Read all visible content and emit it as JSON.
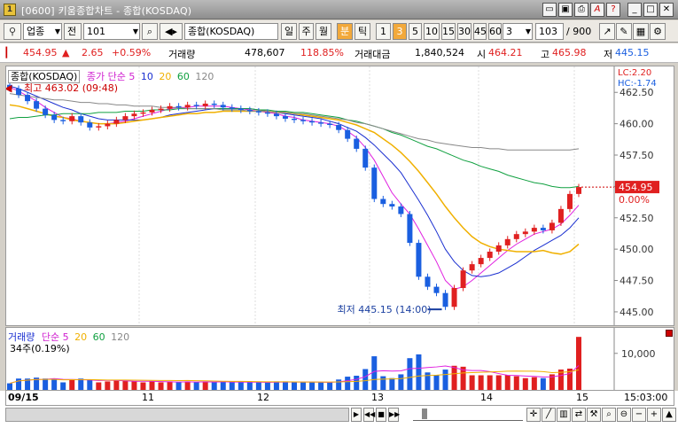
{
  "window": {
    "title": "[0600] 키움종합차트 - 종합(KOSDAQ)",
    "controls": [
      "restore",
      "minimize-alt",
      "print",
      "font",
      "help",
      "minimize",
      "maximize",
      "close"
    ]
  },
  "toolbar": {
    "category": "업종",
    "market": "전",
    "code": "101",
    "name": "종합(KOSDAQ)",
    "periods": [
      "일",
      "주",
      "월",
      "분",
      "틱",
      "1",
      "3",
      "5",
      "10",
      "15",
      "30",
      "45",
      "60"
    ],
    "active_period": "3",
    "period_input": "3",
    "count": "103",
    "count_total": "/ 900"
  },
  "quote": {
    "price": "454.95",
    "arrow": "▲",
    "change": "2.65",
    "rate": "+0.59%",
    "vol_label": "거래량",
    "vol": "478,607",
    "vol_rate": "118.85%",
    "amt_label": "거래대금",
    "amt": "1,840,524",
    "open_label": "시",
    "open": "464.21",
    "high_label": "고",
    "high": "465.98",
    "low_label": "저",
    "low": "445.15"
  },
  "price_pane": {
    "legend_name": "종합(KOSDAQ)",
    "legend_ma": "종가 단순",
    "ma": [
      "5",
      "10",
      "20",
      "60",
      "120"
    ],
    "lc": "LC:2.20",
    "hc": "HC:-1.74",
    "max_ann": "최고 463.02 (09:48)",
    "min_ann": "최저 445.15 (14:00)",
    "last": "454.95",
    "last_pct": "0.00%"
  },
  "volume_pane": {
    "legend_name": "거래량",
    "legend_ma": "단순",
    "ma": [
      "5",
      "20",
      "60",
      "120"
    ],
    "unit": "34주(0.19%)"
  },
  "x_labels": [
    "09/15",
    "11",
    "12",
    "13",
    "14",
    "15"
  ],
  "status_time": "15:03:00",
  "colors": {
    "up": "#e02020",
    "down": "#1a5fe0",
    "ma5": "#e020e0",
    "ma10": "#1a2fd0",
    "ma20": "#f0b000",
    "ma60": "#10a040",
    "ma120": "#888888"
  },
  "chart_data": {
    "type": "candlestick",
    "series": [
      {
        "name": "종합(KOSDAQ)",
        "values": [
          462.8,
          462.3,
          461.8,
          461.2,
          460.7,
          460.3,
          460.2,
          460.6,
          460.1,
          459.7,
          459.8,
          460.0,
          460.3,
          460.6,
          460.8,
          460.9,
          461.1,
          461.2,
          461.4,
          461.3,
          461.5,
          461.4,
          461.6,
          461.5,
          461.3,
          461.2,
          461.1,
          461.0,
          460.9,
          460.8,
          460.6,
          460.4,
          460.3,
          460.2,
          460.1,
          460.0,
          459.9,
          459.5,
          458.8,
          458.0,
          456.5,
          454.0,
          453.6,
          453.4,
          452.8,
          450.5,
          447.8,
          447.0,
          446.5,
          445.4,
          446.9,
          448.3,
          448.8,
          449.3,
          449.8,
          450.3,
          450.8,
          451.2,
          451.4,
          451.7,
          451.5,
          452.1,
          453.2,
          454.4,
          454.95
        ]
      }
    ],
    "ma": {
      "5": [
        462.9,
        462.6,
        462.2,
        461.8,
        461.3,
        460.9,
        460.5,
        460.4,
        460.2,
        460.1,
        460.0,
        460.0,
        460.1,
        460.2,
        460.4,
        460.6,
        460.8,
        461.0,
        461.2,
        461.3,
        461.3,
        461.4,
        461.4,
        461.4,
        461.4,
        461.3,
        461.2,
        461.1,
        461.0,
        460.9,
        460.8,
        460.6,
        460.5,
        460.3,
        460.2,
        460.1,
        460.0,
        459.8,
        459.4,
        458.9,
        458.1,
        457.1,
        455.8,
        454.5,
        453.6,
        452.8,
        451.6,
        450.3,
        449.0,
        447.5,
        446.8,
        447.0,
        447.5,
        448.1,
        448.7,
        449.3,
        449.9,
        450.4,
        450.8,
        451.2,
        451.4,
        451.6,
        452.0,
        452.7,
        453.5
      ],
      "10": [
        463.0,
        462.8,
        462.5,
        462.2,
        461.9,
        461.6,
        461.3,
        461.1,
        460.8,
        460.6,
        460.4,
        460.3,
        460.3,
        460.3,
        460.3,
        460.3,
        460.4,
        460.5,
        460.7,
        460.8,
        460.9,
        461.0,
        461.1,
        461.2,
        461.2,
        461.2,
        461.2,
        461.2,
        461.1,
        461.0,
        460.9,
        460.8,
        460.7,
        460.6,
        460.5,
        460.4,
        460.2,
        460.0,
        459.7,
        459.4,
        458.9,
        458.3,
        457.6,
        456.9,
        456.1,
        455.0,
        453.9,
        452.7,
        451.4,
        450.0,
        449.0,
        448.3,
        447.9,
        447.8,
        447.9,
        448.1,
        448.5,
        448.9,
        449.4,
        449.9,
        450.3,
        450.7,
        451.1,
        451.7,
        452.5
      ],
      "20": [
        461.5,
        461.4,
        461.2,
        461.0,
        460.8,
        460.6,
        460.5,
        460.3,
        460.2,
        460.1,
        460.0,
        460.0,
        460.0,
        460.1,
        460.2,
        460.3,
        460.4,
        460.5,
        460.6,
        460.7,
        460.8,
        460.8,
        460.9,
        460.9,
        461.0,
        461.0,
        461.0,
        461.0,
        461.0,
        461.0,
        460.9,
        460.9,
        460.8,
        460.7,
        460.6,
        460.5,
        460.4,
        460.3,
        460.1,
        459.9,
        459.6,
        459.3,
        458.8,
        458.3,
        457.7,
        457.0,
        456.2,
        455.3,
        454.4,
        453.4,
        452.5,
        451.7,
        451.0,
        450.5,
        450.2,
        450.0,
        449.9,
        449.8,
        449.8,
        449.8,
        449.9,
        449.7,
        449.6,
        449.8,
        450.4
      ],
      "60": [
        460.4,
        460.5,
        460.5,
        460.6,
        460.7,
        460.7,
        460.8,
        460.8,
        460.8,
        460.8,
        460.9,
        460.9,
        460.9,
        461.0,
        461.0,
        461.0,
        461.1,
        461.1,
        461.1,
        461.2,
        461.2,
        461.2,
        461.2,
        461.2,
        461.2,
        461.2,
        461.2,
        461.2,
        461.1,
        461.1,
        461.0,
        461.0,
        460.9,
        460.9,
        460.8,
        460.7,
        460.6,
        460.5,
        460.3,
        460.2,
        460.0,
        459.8,
        459.6,
        459.3,
        459.1,
        458.8,
        458.5,
        458.2,
        458.0,
        457.7,
        457.4,
        457.1,
        456.9,
        456.6,
        456.4,
        456.2,
        455.9,
        455.7,
        455.5,
        455.3,
        455.2,
        455.0,
        454.9,
        454.9,
        455.0
      ],
      "120": [
        462.4,
        462.3,
        462.2,
        462.1,
        462.0,
        461.9,
        461.9,
        461.8,
        461.7,
        461.7,
        461.6,
        461.6,
        461.5,
        461.5,
        461.4,
        461.4,
        461.4,
        461.3,
        461.3,
        461.3,
        461.2,
        461.2,
        461.2,
        461.2,
        461.1,
        461.1,
        461.1,
        461.0,
        461.0,
        461.0,
        460.9,
        460.9,
        460.8,
        460.8,
        460.7,
        460.6,
        460.5,
        460.4,
        460.3,
        460.1,
        460.0,
        459.8,
        459.6,
        459.4,
        459.2,
        459.0,
        458.8,
        458.7,
        458.5,
        458.4,
        458.3,
        458.2,
        458.1,
        458.1,
        458.0,
        458.0,
        457.9,
        457.9,
        457.9,
        457.9,
        457.9,
        457.9,
        457.9,
        457.9,
        458.0
      ]
    },
    "ylim": [
      444.5,
      464.0
    ],
    "yticks": [
      "462.50",
      "460.00",
      "457.50",
      "455.00",
      "452.50",
      "450.00",
      "447.50",
      "445.00"
    ],
    "ytick_values": [
      462.5,
      460.0,
      457.5,
      455.0,
      452.5,
      450.0,
      447.5,
      445.0
    ],
    "volume": {
      "ylim": [
        0,
        16000
      ],
      "yticks": [
        "10,000"
      ],
      "ytick_values": [
        10000
      ]
    }
  }
}
